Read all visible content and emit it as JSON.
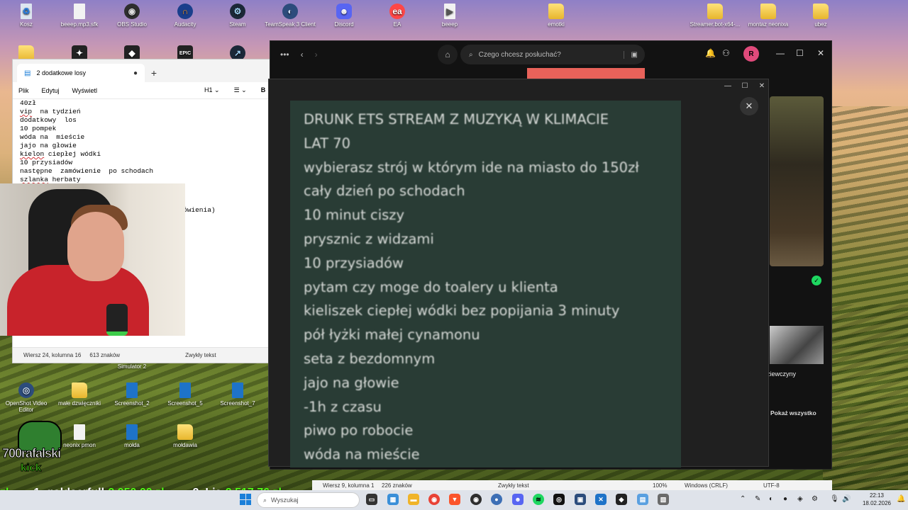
{
  "desktop": {
    "top_icons": [
      {
        "label": "Kosz",
        "icon": "recycle-bin-icon"
      },
      {
        "label": "beeep.mp3.sfk",
        "icon": "file-icon"
      },
      {
        "label": "OBS Studio",
        "icon": "obs-icon"
      },
      {
        "label": "Audacity",
        "icon": "audacity-icon"
      },
      {
        "label": "Steam",
        "icon": "steam-icon"
      },
      {
        "label": "TeamSpeak 3 Client",
        "icon": "teamspeak-icon"
      },
      {
        "label": "Discord",
        "icon": "discord-icon"
      },
      {
        "label": "EA",
        "icon": "ea-icon"
      },
      {
        "label": "beeep",
        "icon": "media-file-icon"
      },
      {
        "label": "emotki",
        "icon": "folder-icon"
      },
      {
        "label": "Streamer.bot-x64-...",
        "icon": "folder-icon"
      },
      {
        "label": "montaz neonixa",
        "icon": "folder-icon"
      },
      {
        "label": "ubez",
        "icon": "folder-icon"
      }
    ],
    "bottom_icons": [
      {
        "label": "OpenShot Video Editor",
        "icon": "openshot-icon"
      },
      {
        "label": "małe dzwięczniki",
        "icon": "folder-icon"
      },
      {
        "label": "Screenshot_2",
        "icon": "image-file-icon"
      },
      {
        "label": "Screenshot_5",
        "icon": "image-file-icon"
      },
      {
        "label": "Screenshot_7",
        "icon": "image-file-icon"
      },
      {
        "label": "neonix pmon",
        "icon": "file-icon"
      },
      {
        "label": "mołda",
        "icon": "image-file-icon"
      },
      {
        "label": "mołdawia",
        "icon": "folder-icon"
      }
    ],
    "partial_label": "Simulator 2"
  },
  "notepad": {
    "tab_title": "2 dodatkowe losy",
    "menu": [
      "Plik",
      "Edytuj",
      "Wyświetl"
    ],
    "heading_select": "H1",
    "bold_label": "B",
    "lines": [
      "40zł",
      "vip  na tydzień",
      "dodatkowy  los",
      "10 pompek",
      "wóda na  mieście",
      "jajo na głowie",
      "kielon ciepłej wódki",
      "10 przysiadów",
      "następne  zamówienie  po schodach",
      "szlanka herbaty"
    ],
    "partial_right_text": "ówienia)",
    "status": {
      "position": "Wiersz 24, kolumna 16",
      "chars": "613 znaków",
      "format": "Zwykły tekst"
    }
  },
  "spotify": {
    "search_placeholder": "Czego chcesz posłuchać?",
    "avatar_letter": "R",
    "girls_label": "ziewczyny",
    "show_all": "Pokaż wszystko"
  },
  "viewer": {
    "lines": [
      "DRUNK ETS STREAM Z MUZYKĄ W KLIMACIE",
      "LAT 70",
      "wybierasz strój w którym ide na miasto do 150zł",
      "cały dzień po schodach",
      "10 minut ciszy",
      "prysznic z widzami",
      "10 przysiadów",
      "pytam czy moge do toalery u klienta",
      "kieliszek ciepłej wódki bez popijania 3 minuty",
      "pół łyżki małej cynamonu",
      "seta z bezdomnym",
      "jajo na głowie",
      "-1h z czasu",
      "piwo po robocie",
      "wóda na mieście"
    ]
  },
  "overlay": {
    "channel_name": "700rafalski",
    "platform": "kick",
    "donations": [
      {
        "prefix": "zł",
        "name": "",
        "amount": ""
      },
      {
        "prefix": "",
        "name": "1. goldserfull: ",
        "amount": "2 950,00 zł"
      },
      {
        "prefix": "",
        "name": "2. Lia: ",
        "amount": "2 517,76 zł"
      }
    ]
  },
  "lower_status": {
    "position": "Wiersz 9, kolumna 1",
    "chars": "226 znaków",
    "format": "Zwykły tekst",
    "zoom": "100%",
    "line_ending": "Windows (CRLF)",
    "encoding": "UTF-8"
  },
  "taskbar": {
    "search_placeholder": "Wyszukaj",
    "time": "22:13",
    "date": "18.02.2026"
  }
}
